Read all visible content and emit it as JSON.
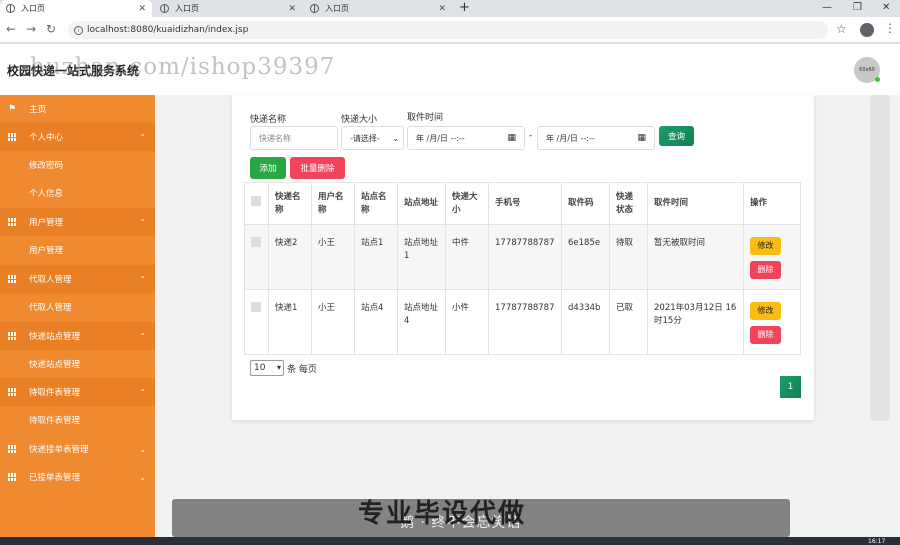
{
  "browser": {
    "tabs": [
      {
        "label": "入口页",
        "active": true
      },
      {
        "label": "入口页",
        "active": false
      },
      {
        "label": "入口页",
        "active": false
      }
    ],
    "url": "localhost:8080/kuaidizhan/index.jsp",
    "window_controls": [
      "—",
      "❐",
      "✕"
    ]
  },
  "header": {
    "title": "校园快递一站式服务系统",
    "watermark": "huzhan.com/ishop39397",
    "avatar_text": "60x60"
  },
  "sidebar": {
    "items": [
      {
        "label": "主页",
        "type": "home"
      },
      {
        "label": "个人中心",
        "type": "group"
      },
      {
        "label": "修改密码",
        "type": "sub"
      },
      {
        "label": "个人信息",
        "type": "sub"
      },
      {
        "label": "用户管理",
        "type": "group"
      },
      {
        "label": "用户管理",
        "type": "sub"
      },
      {
        "label": "代取人管理",
        "type": "group"
      },
      {
        "label": "代取人管理",
        "type": "sub"
      },
      {
        "label": "快递站点管理",
        "type": "group"
      },
      {
        "label": "快递站点管理",
        "type": "sub"
      },
      {
        "label": "待取件表管理",
        "type": "group"
      },
      {
        "label": "待取件表管理",
        "type": "sub"
      },
      {
        "label": "快递接单表管理",
        "type": "group"
      },
      {
        "label": "已接单表管理",
        "type": "group"
      }
    ]
  },
  "search": {
    "name_label": "快递名称",
    "name_placeholder": "快递名称",
    "size_label": "快递大小",
    "size_value": "-请选择-",
    "time_label": "取件时间",
    "date_from": "年 /月/日 --:--",
    "date_sep": "-",
    "date_to": "年 /月/日 --:--",
    "query_button": "查询"
  },
  "actions": {
    "add_button": "添加",
    "batch_delete_button": "批量删除"
  },
  "table": {
    "columns": [
      "快递名称",
      "用户名称",
      "站点名称",
      "站点地址",
      "快递大小",
      "手机号",
      "取件码",
      "快递状态",
      "取件时间",
      "操作"
    ],
    "rows": [
      {
        "name": "快递2",
        "user": "小王",
        "station": "站点1",
        "address": "站点地址1",
        "size": "中件",
        "phone": "17787788787",
        "code": "6e185e",
        "status": "待取",
        "time": "暂无被取时间"
      },
      {
        "name": "快递1",
        "user": "小王",
        "station": "站点4",
        "address": "站点地址4",
        "size": "小件",
        "phone": "17787788787",
        "code": "d4334b",
        "status": "已取",
        "time": "2021年03月12日 16时15分"
      }
    ],
    "edit_label": "修改",
    "delete_label": "删除"
  },
  "pagination": {
    "page_size": "10",
    "page_size_suffix": "条 每页",
    "current_page": "1"
  },
  "overlay": {
    "caption_big": "专业毕设代做",
    "caption_small": "鹅 · 终不会忘笑话"
  },
  "taskbar": {
    "clock": "16:17"
  }
}
